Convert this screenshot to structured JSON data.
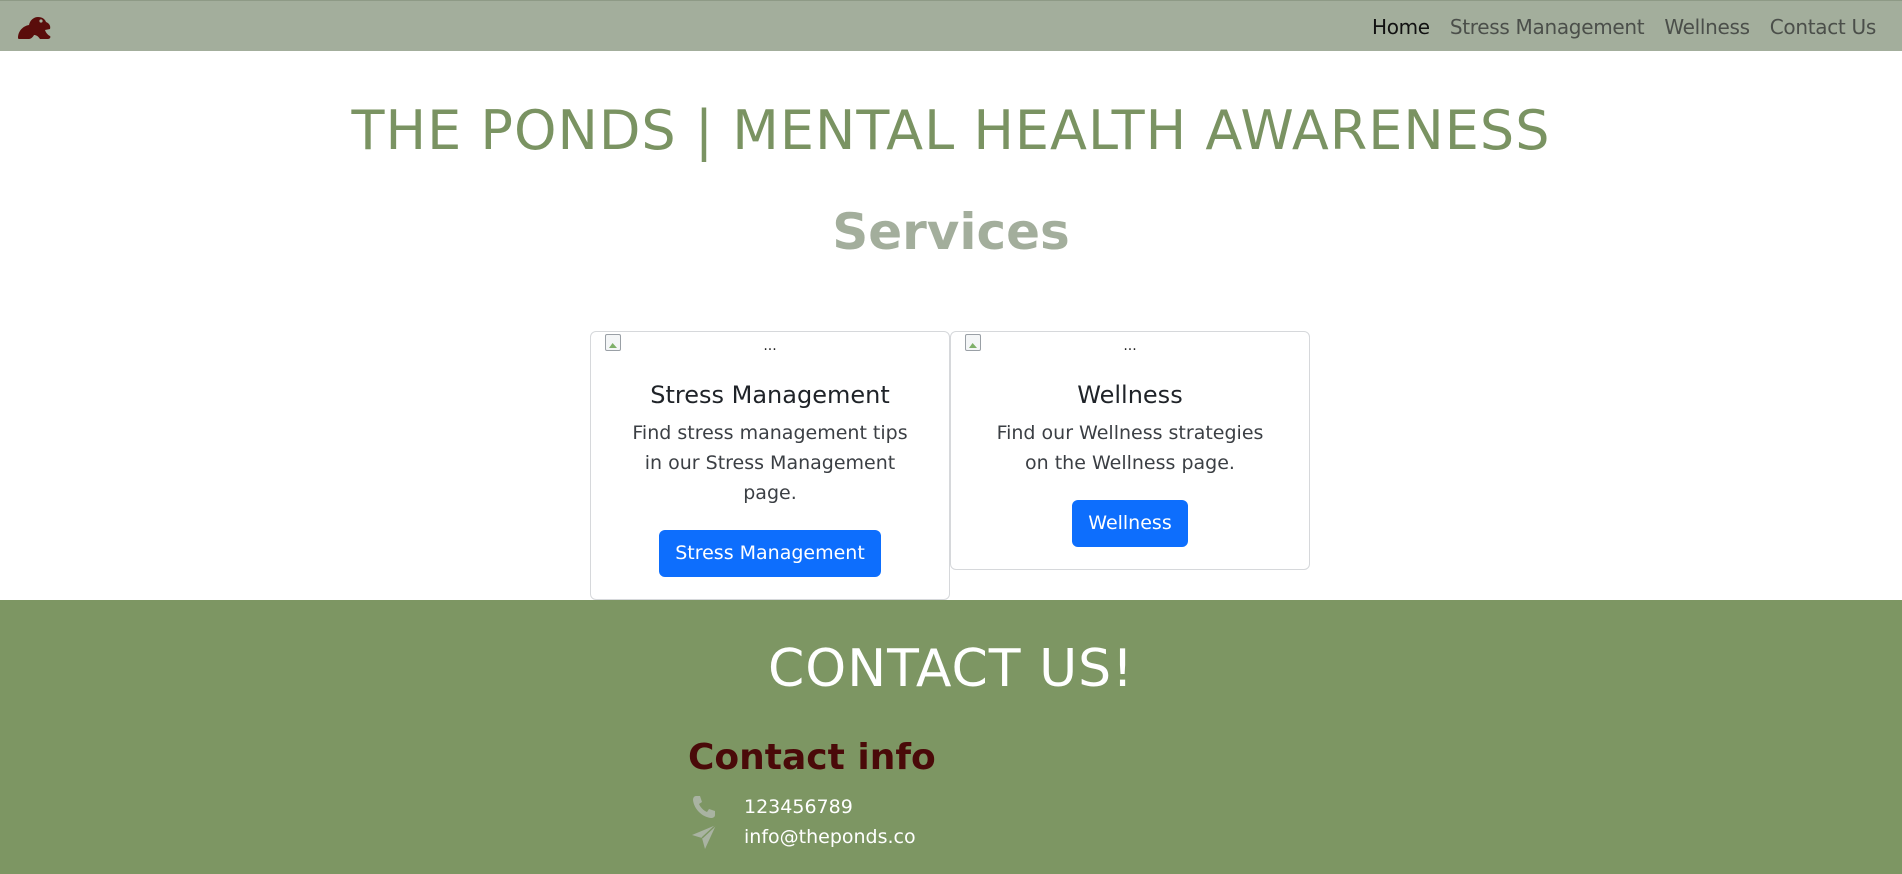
{
  "nav": {
    "brand_icon": "frog-icon",
    "links": [
      "Home",
      "Stress Management",
      "Wellness",
      "Contact Us"
    ]
  },
  "header": {
    "title": "THE PONDS | MENTAL HEALTH AWARENESS",
    "subtitle": "Services"
  },
  "cards": [
    {
      "image_alt": "...",
      "title": "Stress Management",
      "text": "Find stress management tips in our Stress Management page.",
      "button": "Stress Management"
    },
    {
      "image_alt": "...",
      "title": "Wellness",
      "text": "Find our Wellness strategies on the Wellness page.",
      "button": "Wellness"
    }
  ],
  "footer": {
    "title": "CONTACT US!",
    "info_title": "Contact info",
    "phone_icon": "phone-icon",
    "phone": "123456789",
    "email_icon": "paper-plane-icon",
    "email": "info@theponds.co"
  },
  "colors": {
    "navbar_bg": "#a3ae9c",
    "title_green": "#7a9362",
    "footer_bg": "#7d9663",
    "button_blue": "#0d6efd",
    "contact_info_title": "#4a0a09"
  }
}
